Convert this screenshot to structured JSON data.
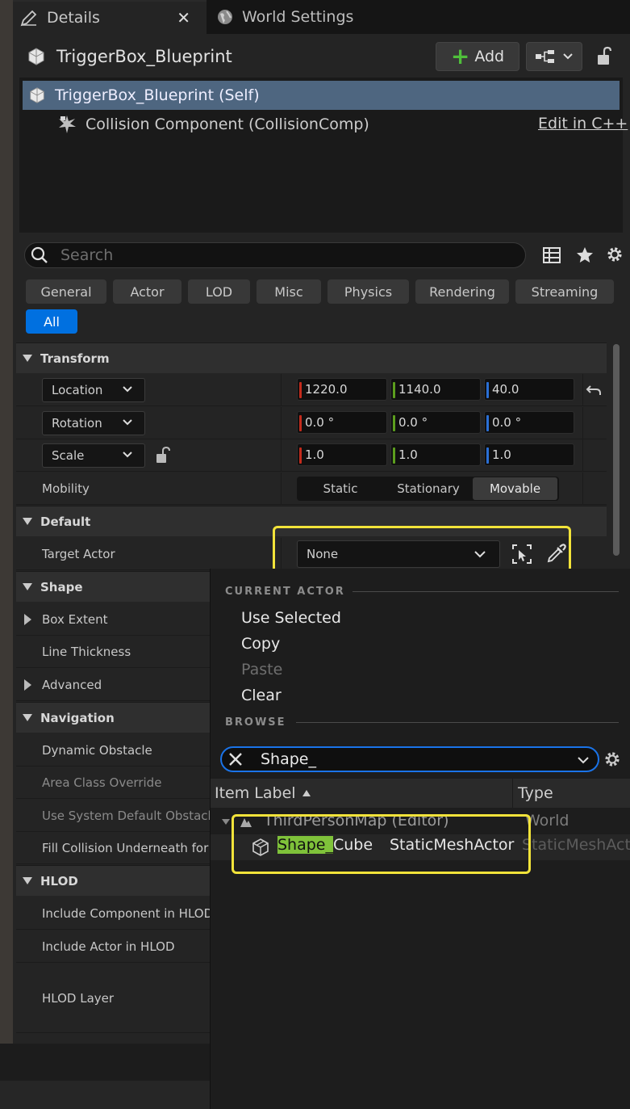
{
  "tabs": [
    {
      "label": "Details"
    },
    {
      "label": "World Settings"
    }
  ],
  "header": {
    "title": "TriggerBox_Blueprint",
    "add_label": "Add"
  },
  "tree": {
    "self_label": "TriggerBox_Blueprint (Self)",
    "component_label": "Collision Component (CollisionComp)",
    "edit_link": "Edit in C++"
  },
  "search": {
    "placeholder": "Search"
  },
  "filters": [
    "General",
    "Actor",
    "LOD",
    "Misc",
    "Physics",
    "Rendering",
    "Streaming",
    "All"
  ],
  "transform": {
    "title": "Transform",
    "location": {
      "label": "Location",
      "x": "1220.0",
      "y": "1140.0",
      "z": "40.0"
    },
    "rotation": {
      "label": "Rotation",
      "x": "0.0 °",
      "y": "0.0 °",
      "z": "0.0 °"
    },
    "scale": {
      "label": "Scale",
      "x": "1.0",
      "y": "1.0",
      "z": "1.0"
    },
    "mobility": {
      "label": "Mobility",
      "options": [
        "Static",
        "Stationary",
        "Movable"
      ],
      "selected": "Movable"
    }
  },
  "default": {
    "title": "Default",
    "target_actor_label": "Target Actor",
    "target_actor_value": "None"
  },
  "shape": {
    "title": "Shape",
    "box_extent": "Box Extent",
    "line_thickness": "Line Thickness",
    "advanced": "Advanced"
  },
  "navigation": {
    "title": "Navigation",
    "dynamic_obstacle": "Dynamic Obstacle",
    "area_class_override": "Area Class Override",
    "use_system_default": "Use System Default Obstacle",
    "fill_collision": "Fill Collision Underneath for N"
  },
  "hlod": {
    "title": "HLOD",
    "include_component": "Include Component in HLOD",
    "include_actor": "Include Actor in HLOD",
    "hlod_layer": "HLOD Layer"
  },
  "popup": {
    "current_actor_header": "CURRENT ACTOR",
    "use_selected": "Use Selected",
    "copy": "Copy",
    "paste": "Paste",
    "clear": "Clear",
    "browse_header": "BROWSE",
    "filter_value": "Shape_",
    "col_item_label": "Item Label",
    "col_type": "Type",
    "world_row": {
      "label": "ThirdPersonMap (Editor)",
      "type": "World"
    },
    "result_row": {
      "match": "Shape_",
      "rest": "Cube",
      "type_inline": "StaticMeshActor",
      "type_col": "StaticMeshActo"
    }
  },
  "colors": {
    "x_axis": "#c42b1c",
    "y_axis": "#5c9e1e",
    "z_axis": "#2a6fd6",
    "highlight": "#f2e33a",
    "selected_row": "#4e6680",
    "accent": "#0070e0"
  }
}
